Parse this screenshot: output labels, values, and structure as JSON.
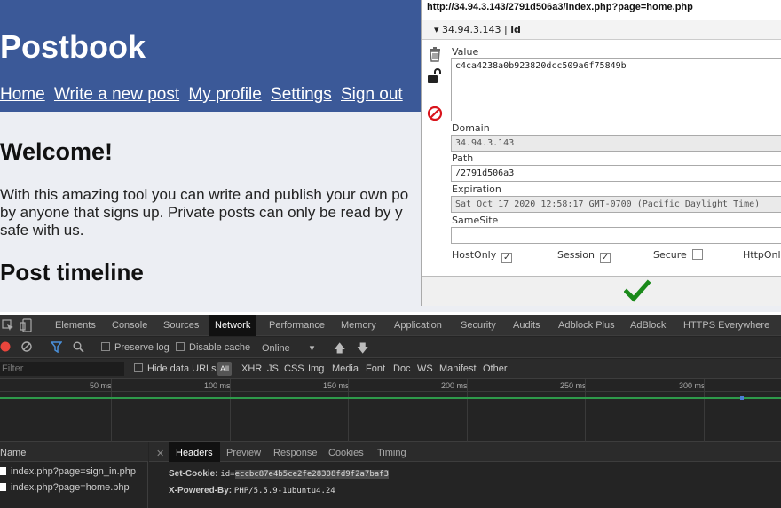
{
  "site": {
    "title": "Postbook",
    "nav": [
      "Home",
      "Write a new post",
      "My profile",
      "Settings",
      "Sign out"
    ],
    "welcome": "Welcome!",
    "intro_lines": [
      "With this amazing tool you can write and publish your own po",
      "by anyone that signs up. Private posts can only be read by y",
      "safe with us."
    ],
    "timeline_heading": "Post timeline"
  },
  "cookie_editor": {
    "url": "http://34.94.3.143/2791d506a3/index.php?page=home.php",
    "cookie_host": "34.94.3.143",
    "cookie_separator": "|",
    "cookie_name": "id",
    "value_label": "Value",
    "value": "c4ca4238a0b923820dcc509a6f75849b",
    "domain_label": "Domain",
    "domain": "34.94.3.143",
    "path_label": "Path",
    "path": "/2791d506a3",
    "expiration_label": "Expiration",
    "expiration": "Sat Oct 17 2020 12:58:17 GMT-0700 (Pacific Daylight Time)",
    "samesite_label": "SameSite",
    "samesite": "",
    "flags": [
      {
        "label": "HostOnly",
        "checked": true
      },
      {
        "label": "Session",
        "checked": true
      },
      {
        "label": "Secure",
        "checked": false
      },
      {
        "label": "HttpOnl",
        "checked": false
      }
    ],
    "icons": [
      "trash-icon",
      "lock-open-icon",
      "block-icon",
      "checkmark-icon"
    ]
  },
  "devtools": {
    "tabs": [
      "Elements",
      "Console",
      "Sources",
      "Network",
      "Performance",
      "Memory",
      "Application",
      "Security",
      "Audits",
      "Adblock Plus",
      "AdBlock",
      "HTTPS Everywhere"
    ],
    "active_tab": "Network",
    "toolbar": {
      "preserve_log": "Preserve log",
      "disable_cache": "Disable cache",
      "throttle": "Online"
    },
    "filter": {
      "placeholder": "Filter",
      "hide_data_urls": "Hide data URLs",
      "all": "All",
      "types": [
        "XHR",
        "JS",
        "CSS",
        "Img",
        "Media",
        "Font",
        "Doc",
        "WS",
        "Manifest",
        "Other"
      ]
    },
    "timeline_ticks": [
      "50 ms",
      "100 ms",
      "150 ms",
      "200 ms",
      "250 ms",
      "300 ms"
    ],
    "name_header": "Name",
    "requests": [
      "index.php?page=sign_in.php",
      "index.php?page=home.php"
    ],
    "detail_tabs": [
      "Headers",
      "Preview",
      "Response",
      "Cookies",
      "Timing"
    ],
    "active_detail_tab": "Headers",
    "response_headers": [
      {
        "key": "Set-Cookie:",
        "prefix": "id=",
        "value": "eccbc87e4b5ce2fe28308fd9f2a7baf3"
      },
      {
        "key": "X-Powered-By:",
        "prefix": "",
        "value": "PHP/5.5.9-1ubuntu4.24"
      }
    ]
  },
  "colors": {
    "header_blue": "#3b5998",
    "devtools_bg": "#242424",
    "save_green": "#1a8a1a",
    "block_red": "#d9141c"
  }
}
